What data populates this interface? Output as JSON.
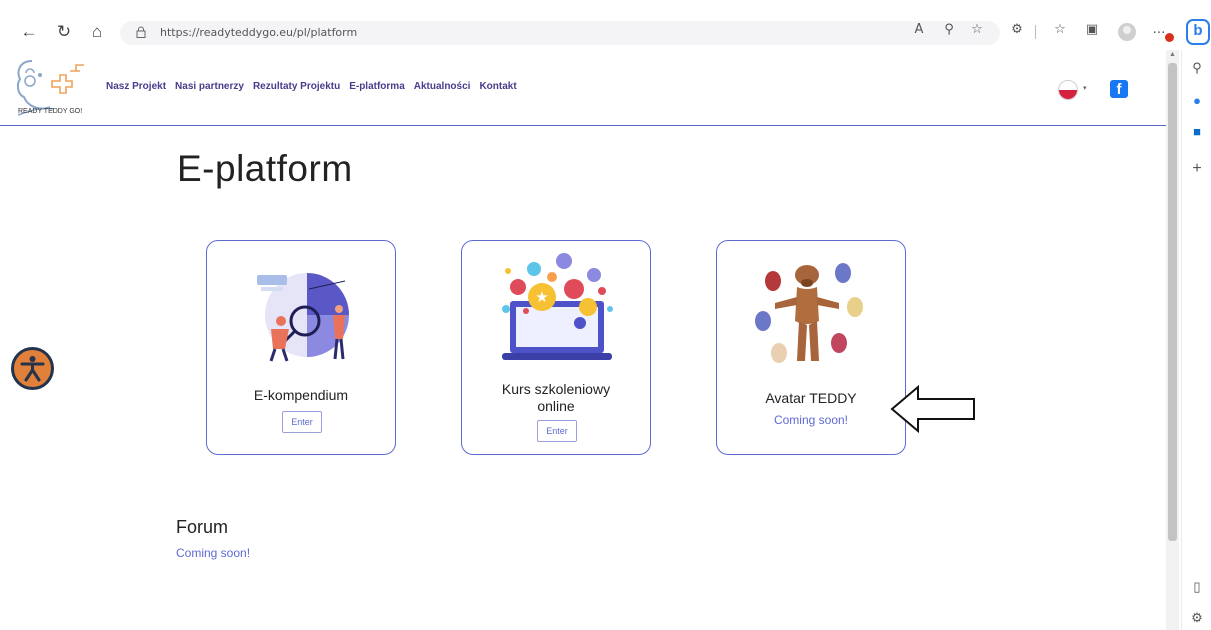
{
  "browser": {
    "url": "https://readyteddygo.eu/pl/platform",
    "icons": [
      "back-icon",
      "refresh-icon",
      "home-icon",
      "lock-icon",
      "read-aloud-icon",
      "zoom-icon",
      "favorite-icon",
      "extensions-icon",
      "favorites-icon",
      "collections-icon",
      "profile-icon",
      "more-icon",
      "bing-icon"
    ],
    "read_aloud_label": "A",
    "bing_label": "b"
  },
  "sidebar": {
    "icons": [
      "search-icon",
      "office-icon",
      "outlook-icon",
      "add-icon",
      "panel-icon",
      "settings-icon"
    ],
    "add_label": "+"
  },
  "header": {
    "logo_text": "READY TEDDY GO!",
    "nav": [
      "Nasz Projekt",
      "Nasi partnerzy",
      "Rezultaty Projektu",
      "E-platforma",
      "Aktualności",
      "Kontakt"
    ],
    "facebook_label": "f",
    "language_flag": "pl-flag-icon"
  },
  "page": {
    "title": "E-platform",
    "cards": [
      {
        "title": "E-kompendium",
        "button": "Enter"
      },
      {
        "title": "Kurs szkoleniowy online",
        "button": "Enter"
      },
      {
        "title": "Avatar TEDDY",
        "status": "Coming soon!"
      }
    ],
    "forum": {
      "title": "Forum",
      "status": "Coming soon!"
    }
  },
  "colors": {
    "accent": "#5f6ad3",
    "nav_text": "#4a3b8c",
    "accessibility_bg": "#e0803a",
    "facebook": "#1877f2"
  }
}
